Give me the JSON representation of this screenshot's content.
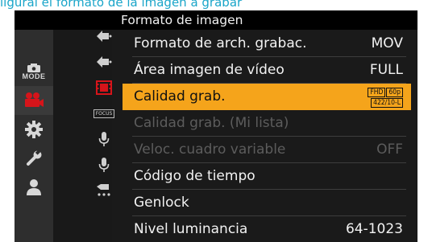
{
  "header_text": "ligural el formato de la imagen a grabar",
  "screen_title": "Formato de imagen",
  "left_tabs": [
    {
      "icon": "camera-mode-icon",
      "label": "MODE"
    },
    {
      "icon": "video-camera-icon"
    },
    {
      "icon": "gear-icon"
    },
    {
      "icon": "wrench-icon"
    },
    {
      "icon": "person-icon"
    }
  ],
  "sub_tabs": [
    {
      "icon": "movie-camera-icon"
    },
    {
      "icon": "movie-camera-icon"
    },
    {
      "icon": "film-icon"
    },
    {
      "icon": "focus-icon",
      "label": "FOCUS"
    },
    {
      "icon": "microphone-icon"
    },
    {
      "icon": "microphone-icon"
    },
    {
      "icon": "timecode-icon"
    }
  ],
  "menu": {
    "items": [
      {
        "label": "Formato de arch. grabac.",
        "value": "MOV",
        "state": "normal"
      },
      {
        "label": "Área imagen de vídeo",
        "value": "FULL",
        "state": "normal"
      },
      {
        "label": "Calidad grab.",
        "badge": {
          "top": [
            "FHD",
            "60p"
          ],
          "bottom": "422/10-L"
        },
        "state": "selected"
      },
      {
        "label": "Calidad grab. (Mi lista)",
        "value": "",
        "state": "disabled"
      },
      {
        "label": "Veloc. cuadro variable",
        "value": "OFF",
        "state": "disabled"
      },
      {
        "label": "Código de tiempo",
        "value": "",
        "state": "normal"
      },
      {
        "label": "Genlock",
        "value": "",
        "state": "normal"
      },
      {
        "label": "Nivel luminancia",
        "value": "64-1023",
        "state": "normal"
      }
    ]
  },
  "colors": {
    "accent": "#f5a41b",
    "header": "#1aa5c9",
    "disabled": "#5c5c5c"
  }
}
